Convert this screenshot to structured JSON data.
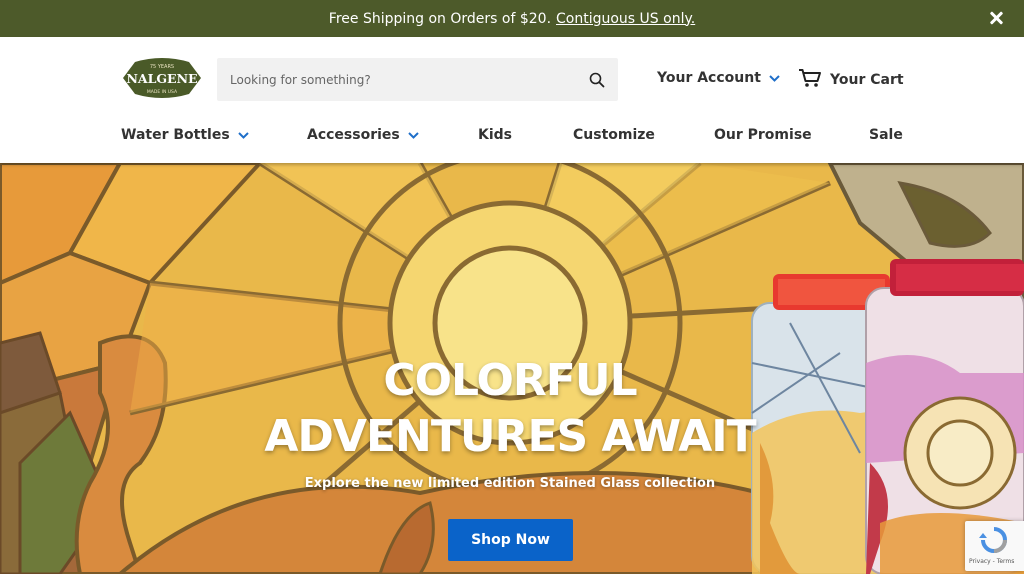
{
  "announcement": {
    "text": "Free Shipping on Orders of $20.",
    "link": "Contiguous US only."
  },
  "header": {
    "logo": {
      "top_text": "75 YEARS",
      "brand": "NALGENE",
      "bottom_text": "MADE IN USA"
    },
    "search": {
      "placeholder": "Looking for something?"
    },
    "account_label": "Your Account",
    "cart_label": "Your Cart"
  },
  "nav": {
    "items": [
      {
        "label": "Water Bottles",
        "has_dropdown": true
      },
      {
        "label": "Accessories",
        "has_dropdown": true
      },
      {
        "label": "Kids",
        "has_dropdown": false
      },
      {
        "label": "Customize",
        "has_dropdown": false
      },
      {
        "label": "Our Promise",
        "has_dropdown": false
      },
      {
        "label": "Sale",
        "has_dropdown": false
      }
    ]
  },
  "hero": {
    "title_line1": "COLORFUL",
    "title_line2": "ADVENTURES AWAIT",
    "subtitle": "Explore the new limited edition Stained Glass collection",
    "cta": "Shop Now"
  },
  "recaptcha": {
    "text": "Privacy - Terms"
  },
  "colors": {
    "announcement_bg": "#4d5a2a",
    "logo_green": "#4a5a28",
    "accent_blue": "#0a63c9",
    "chevron_blue": "#1f6fc9"
  },
  "icons": [
    "close-icon",
    "search-icon",
    "chevron-down-icon",
    "cart-icon",
    "recaptcha-icon"
  ]
}
